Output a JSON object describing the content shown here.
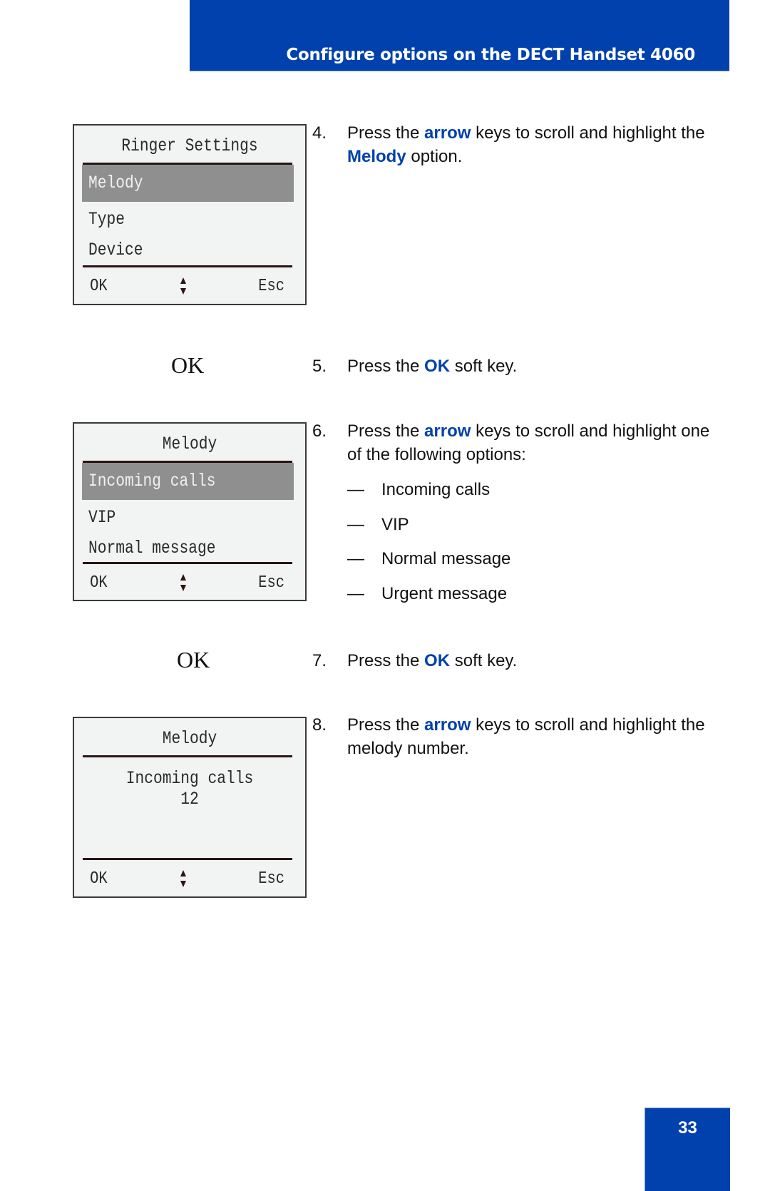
{
  "header": {
    "title": "Configure options on the DECT Handset 4060"
  },
  "screens": [
    {
      "title": "Ringer Settings",
      "items": [
        {
          "label": "Melody",
          "selected": true
        },
        {
          "label": "Type",
          "selected": false
        },
        {
          "label": "Device",
          "selected": false
        }
      ],
      "softkeys": {
        "left": "OK",
        "right": "Esc"
      }
    },
    {
      "title": "Melody",
      "items": [
        {
          "label": "Incoming calls",
          "selected": true
        },
        {
          "label": "VIP",
          "selected": false
        },
        {
          "label": "Normal message",
          "selected": false
        }
      ],
      "softkeys": {
        "left": "OK",
        "right": "Esc"
      }
    },
    {
      "title": "Melody",
      "detail_line1": "Incoming calls",
      "detail_line2": "12",
      "softkeys": {
        "left": "OK",
        "right": "Esc"
      }
    }
  ],
  "ok_keys": [
    "OK",
    "OK"
  ],
  "steps": [
    {
      "num": "4.",
      "parts": [
        "Press the ",
        "arrow",
        " keys to scroll and highlight the ",
        "Melody",
        " option."
      ]
    },
    {
      "num": "5.",
      "parts": [
        "Press the ",
        "OK",
        " soft key."
      ]
    },
    {
      "num": "6.",
      "parts": [
        "Press the ",
        "arrow",
        " keys to scroll and highlight one of the following options:"
      ]
    },
    {
      "num": "7.",
      "parts": [
        "Press the ",
        "OK",
        " soft key."
      ]
    },
    {
      "num": "8.",
      "parts": [
        "Press the ",
        "arrow",
        " keys to scroll and highlight the melody number."
      ]
    }
  ],
  "options": {
    "dash": "—",
    "items": [
      "Incoming calls",
      "VIP",
      "Normal message",
      "Urgent message"
    ]
  },
  "page_number": "33",
  "colors": {
    "brand_blue": "#0041ad",
    "highlight_gray": "#8f8f8f",
    "lcd_background": "#f2f3f3"
  }
}
